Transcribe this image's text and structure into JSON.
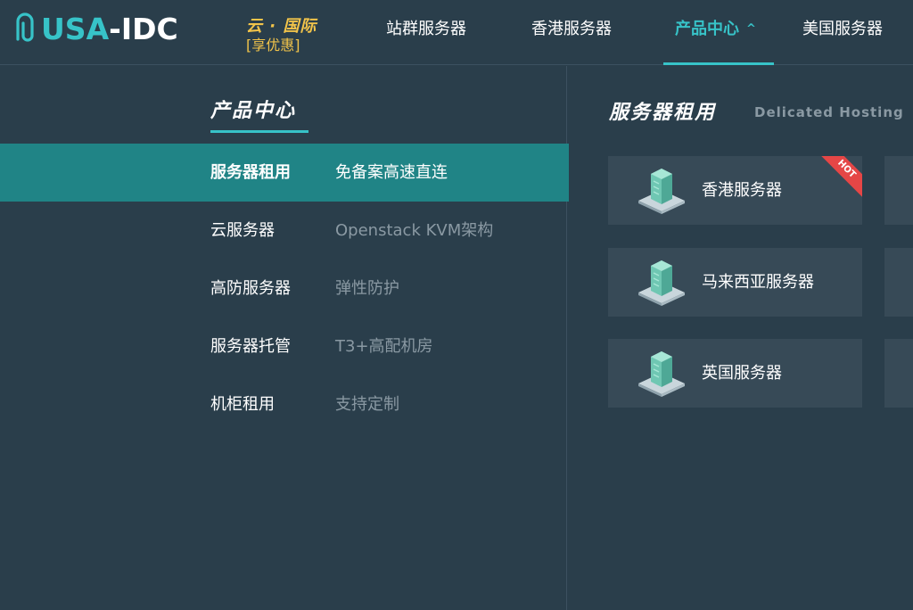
{
  "header": {
    "logo": {
      "left": "USA",
      "dash": "-",
      "right": "IDC"
    },
    "promo": {
      "top": "云 · 国际",
      "bottom": "[享优惠]"
    },
    "nav": [
      {
        "label": "站群服务器"
      },
      {
        "label": "香港服务器"
      },
      {
        "label": "产品中心",
        "active": true,
        "chevron": "^"
      },
      {
        "label": "美国服务器"
      }
    ]
  },
  "left_panel": {
    "title": "产品中心",
    "items": [
      {
        "label": "服务器租用",
        "desc": "免备案高速直连",
        "active": true
      },
      {
        "label": "云服务器",
        "desc": "Openstack KVM架构"
      },
      {
        "label": "高防服务器",
        "desc": "弹性防护"
      },
      {
        "label": "服务器托管",
        "desc": "T3+高配机房"
      },
      {
        "label": "机柜租用",
        "desc": "支持定制"
      }
    ]
  },
  "right_panel": {
    "title": "服务器租用",
    "subtitle": "Delicated Hosting",
    "cards": [
      {
        "label": "香港服务器",
        "badge": "HOT"
      },
      {
        "label": "马来西亚服务器"
      },
      {
        "label": "英国服务器"
      }
    ]
  },
  "colors": {
    "accent": "#37c3c8",
    "promo": "#f2c44a",
    "active_row": "#208486",
    "hot": "#e54646"
  },
  "icons": [
    "server-building-icon",
    "chevron-up-icon",
    "logo-clip-icon"
  ]
}
